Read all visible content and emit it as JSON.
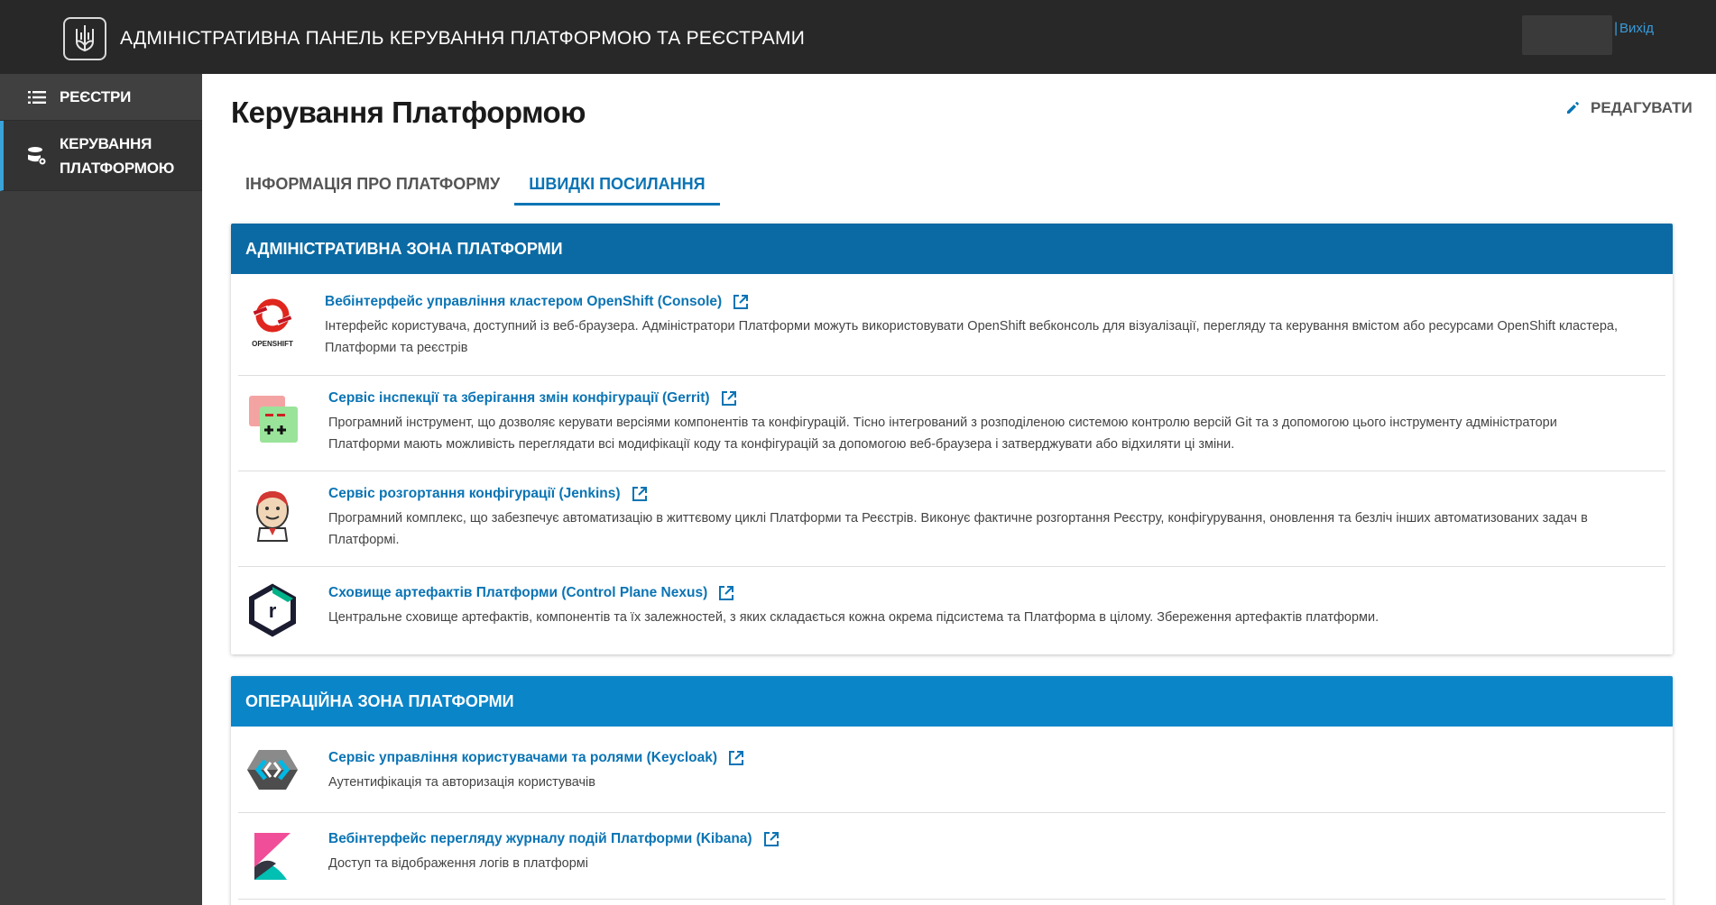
{
  "header": {
    "title": "АДМІНІСТРАТИВНА ПАНЕЛЬ КЕРУВАННЯ ПЛАТФОРМОЮ ТА РЕЄСТРАМИ",
    "separator": "|",
    "logout": "Вихід"
  },
  "sidebar": {
    "items": [
      {
        "label": "РЕЄСТРИ",
        "icon": "list-icon"
      },
      {
        "label_line1": "КЕРУВАННЯ",
        "label_line2": "ПЛАТФОРМОЮ",
        "icon": "database-gear-icon"
      }
    ]
  },
  "page": {
    "title": "Керування Платформою",
    "edit_label": "РЕДАГУВАТИ"
  },
  "tabs": [
    {
      "label": "ІНФОРМАЦІЯ ПРО ПЛАТФОРМУ"
    },
    {
      "label": "ШВИДКІ ПОСИЛАННЯ"
    }
  ],
  "admin_zone": {
    "title": "АДМІНІСТРАТИВНА ЗОНА ПЛАТФОРМИ",
    "links": [
      {
        "title": "Вебінтерфейс управління кластером OpenShift (Console)",
        "desc_line1": "Інтерфейс користувача, доступний із веб-браузера. Адміністратори Платформи можуть використовувати OpenShift вебконсоль для візуалізації, перегляду та керування вмістом або ресурсами OpenShift кластера,",
        "desc_line2": "Платформи та реєстрів",
        "icon": "openshift-icon",
        "logo_text": "OPENSHIFT"
      },
      {
        "title": "Сервіс інспекції та зберігання змін конфігурації (Gerrit)",
        "desc_line1": "Програмний інструмент, що дозволяє керувати версіями компонентів та конфігурацій. Тісно інтегрований з розподіленою системою контролю версій Git та з допомогою цього інструменту адміністратори",
        "desc_line2": "Платформи мають можливість переглядати всі модифікації коду та конфігурацій за допомогою веб-браузера і затверджувати або відхиляти ці зміни.",
        "icon": "gerrit-icon"
      },
      {
        "title": "Сервіс розгортання конфігурації (Jenkins)",
        "desc_line1": "Програмний комплекс, що забезпечує автоматизацію в життєвому циклі Платформи та Реєстрів. Виконує фактичне розгортання Реєстру, конфігурування, оновлення та безліч інших автоматизованих задач в",
        "desc_line2": "Платформі.",
        "icon": "jenkins-icon"
      },
      {
        "title": "Сховище артефактів Платформи (Control Plane Nexus)",
        "desc_line1": "Центральне сховище артефактів, компонентів та їх залежностей, з яких складається кожна окрема підсистема та Платформа в цілому. Збереження артефактів платформи.",
        "desc_line2": "",
        "icon": "nexus-icon",
        "logo_text": "r"
      }
    ]
  },
  "ops_zone": {
    "title": "ОПЕРАЦІЙНА ЗОНА ПЛАТФОРМИ",
    "links": [
      {
        "title": "Сервіс управління користувачами та ролями (Keycloak)",
        "desc_line1": "Аутентифікація та авторизація користувачів",
        "icon": "keycloak-icon"
      },
      {
        "title": "Вебінтерфейс перегляду журналу подій Платформи (Kibana)",
        "desc_line1": "Доступ та відображення логів в платформі",
        "icon": "kibana-icon"
      }
    ]
  },
  "colors": {
    "topbar": "#282828",
    "sidebar": "#3d3d3d",
    "admin_header": "#0b6aa3",
    "ops_header": "#0a85c8",
    "link": "#0a74b4"
  }
}
